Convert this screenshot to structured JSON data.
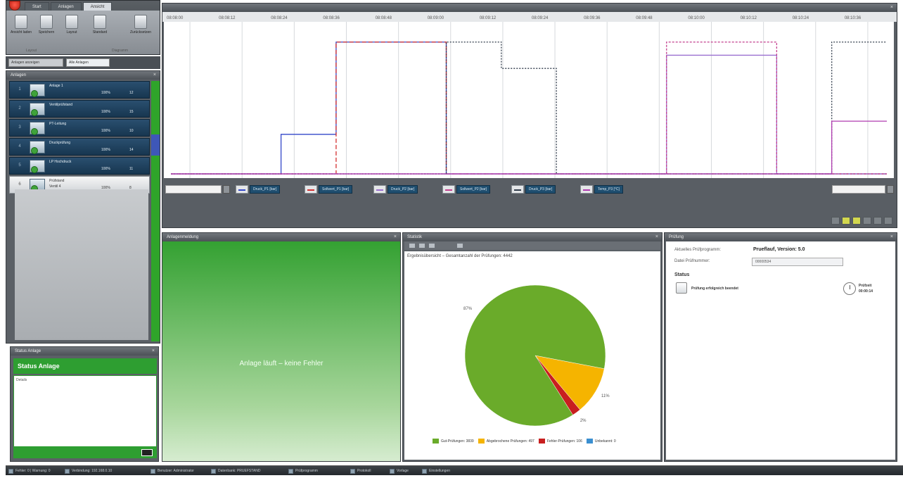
{
  "ribbon": {
    "tabs": [
      "Start",
      "Anlagen",
      "Ansicht"
    ],
    "active_tab": "Ansicht",
    "buttons": [
      "Ansicht laden",
      "Speichern",
      "Layout",
      "Standard",
      "Zurücksetzen"
    ],
    "groups": [
      "Layout",
      "Diagramm"
    ]
  },
  "filter": {
    "first": "Anlagen anzeigen",
    "second": "Alle Anlagen"
  },
  "anlagen": {
    "title": "Anlagen",
    "devices": [
      {
        "num": "1",
        "name": "Anlage 1",
        "pct": "100%",
        "count": "12"
      },
      {
        "num": "2",
        "name": "Ventilprüfstand",
        "pct": "100%",
        "count": "15"
      },
      {
        "num": "3",
        "name": "PT-Leitung",
        "pct": "100%",
        "count": "10"
      },
      {
        "num": "4",
        "name": "Druckprüfung",
        "pct": "100%",
        "count": "14"
      },
      {
        "num": "5",
        "name": "LP Hochdruck",
        "pct": "100%",
        "count": "11"
      },
      {
        "num": "6",
        "name": "Prüfstand",
        "sub": "Ventil 4",
        "pct": "100%",
        "count": "8"
      }
    ]
  },
  "status_anlage": {
    "panel_title": "Status Anlage",
    "title": "Status Anlage",
    "content_label": "Details"
  },
  "chart": {
    "time_labels": [
      "08:08:00",
      "08:08:12",
      "08:08:24",
      "08:08:36",
      "08:08:48",
      "08:09:00",
      "08:09:12",
      "08:09:24",
      "08:09:36",
      "08:09:48",
      "08:10:00",
      "08:10:12",
      "08:10:24",
      "08:10:36"
    ],
    "legend": [
      {
        "label": "Druck_P1 [bar]",
        "color": "#3347c9"
      },
      {
        "label": "Sollwert_P1 [bar]",
        "color": "#d33030"
      },
      {
        "label": "Druck_P2 [bar]",
        "color": "#9a6fd0"
      },
      {
        "label": "Sollwert_P2 [bar]",
        "color": "#c43f8e"
      },
      {
        "label": "Druck_P3 [bar]",
        "color": "#2f3a4a"
      },
      {
        "label": "Temp_P3 [°C]",
        "color": "#b03bb0"
      }
    ]
  },
  "chart_data": {
    "type": "line",
    "x": [
      0,
      1,
      2,
      3,
      4,
      5,
      6,
      7,
      8,
      9,
      10,
      11,
      12,
      13
    ],
    "series": [
      {
        "name": "Druck_P1 [bar]",
        "values": [
          0,
          0,
          30,
          100,
          100,
          0,
          0,
          0,
          0,
          0,
          0,
          0,
          0,
          0
        ]
      },
      {
        "name": "Sollwert_P1 [bar]",
        "values": [
          0,
          0,
          0,
          100,
          100,
          0,
          0,
          0,
          0,
          0,
          0,
          0,
          0,
          0
        ]
      },
      {
        "name": "Druck_P2 [bar]",
        "values": [
          0,
          0,
          0,
          0,
          0,
          0,
          0,
          0,
          0,
          90,
          90,
          0,
          0,
          0
        ]
      },
      {
        "name": "Sollwert_P2 [bar]",
        "values": [
          0,
          0,
          0,
          0,
          0,
          0,
          0,
          0,
          0,
          100,
          100,
          0,
          0,
          0
        ]
      },
      {
        "name": "Druck_P3 [bar]",
        "values": [
          0,
          0,
          0,
          0,
          0,
          100,
          80,
          0,
          0,
          0,
          0,
          0,
          100,
          100
        ]
      },
      {
        "name": "Temp_P3 [°C]",
        "values": [
          0,
          0,
          0,
          0,
          0,
          0,
          0,
          0,
          0,
          0,
          0,
          0,
          40,
          40
        ]
      }
    ],
    "ylim": [
      0,
      110
    ]
  },
  "nachricht": {
    "panel_title": "Anlagenmeldung",
    "message": "Anlage läuft – keine Fehler"
  },
  "stats": {
    "panel_title": "Statistik",
    "title": "Ergebnisübersicht – Gesamtanzahl der Prüfungen: 4442",
    "pie": [
      {
        "label": "Gut-Prüfungen: 3839",
        "value": 87,
        "pct_text": "87%",
        "color": "#6aab2a"
      },
      {
        "label": "Abgebrochene Prüfungen: 497",
        "value": 11,
        "pct_text": "11%",
        "color": "#f5b400"
      },
      {
        "label": "Fehler-Prüfungen: 106",
        "value": 2,
        "pct_text": "2%",
        "color": "#c81f1f"
      },
      {
        "label": "Unbekannt: 0",
        "value": 0,
        "pct_text": "",
        "color": "#3a8fd0"
      }
    ]
  },
  "pruefung": {
    "panel_title": "Prüfung",
    "aktuelles_label": "Aktuelles Prüfprogramm:",
    "aktuelles_value": "Prueflauf, Version: 5.0",
    "datei_label": "Datei Prüfnummer:",
    "datei_value": "00000534",
    "status_heading": "Status",
    "status_text": "Prüfung erfolgreich beendet",
    "time_label": "Prüfzeit",
    "time_value": "00:00:14"
  },
  "statusbar": [
    "Fehler: 0 | Warnung: 0",
    "Verbindung: 192.168.0.10",
    "Benutzer: Administrator",
    "Datenbank: PRUEFSTAND",
    "Prüfprogramm",
    "Protokoll",
    "Vorlage",
    "Einstellungen"
  ]
}
